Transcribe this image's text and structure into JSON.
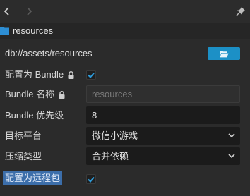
{
  "asset": {
    "name": "resources",
    "path": "db://assets/resources"
  },
  "icons": {
    "back": "chevron-left-icon",
    "forward": "chevron-right-icon",
    "pin": "pin-icon",
    "folder": "folder-icon",
    "open_folder": "folder-open-icon",
    "lock": "lock-icon",
    "check": "checkmark-icon",
    "dropdown": "chevron-down-icon"
  },
  "colors": {
    "accent": "#1c90c6",
    "highlight": "#3c6eaa",
    "folder": "#2d8ed4"
  },
  "properties": {
    "is_bundle": {
      "label": "配置为 Bundle",
      "checked": true
    },
    "bundle_name": {
      "label": "Bundle 名称",
      "placeholder": "resources",
      "value": ""
    },
    "bundle_priority": {
      "label": "Bundle 优先级",
      "value": "8"
    },
    "target_platform": {
      "label": "目标平台",
      "selected": "微信小游戏"
    },
    "compression_type": {
      "label": "压缩类型",
      "selected": "合并依赖"
    },
    "is_remote": {
      "label": "配置为远程包",
      "checked": true
    }
  }
}
